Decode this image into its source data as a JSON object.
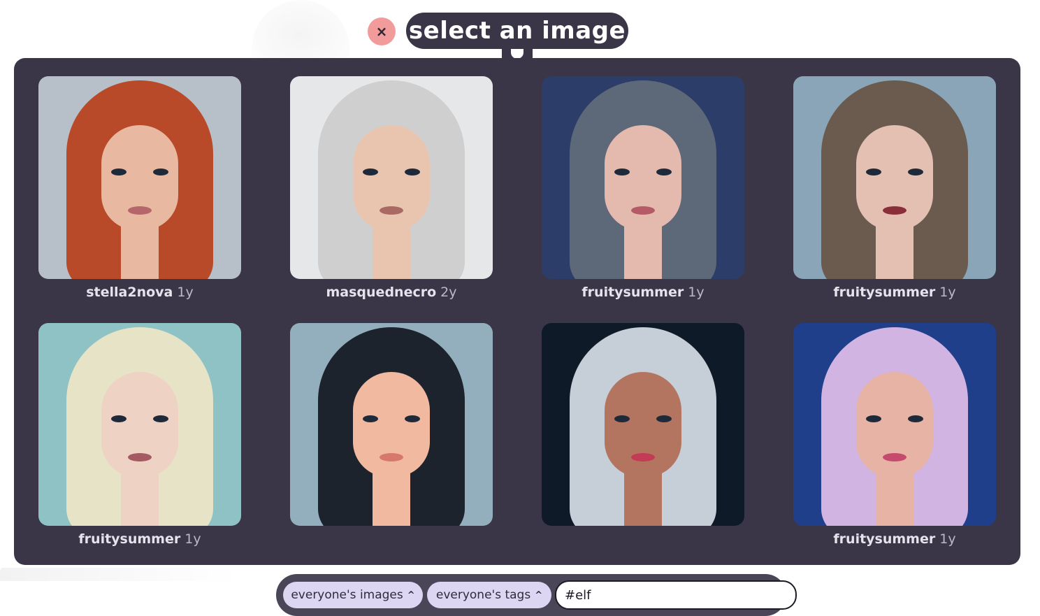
{
  "header": {
    "title": "select an image",
    "close_label": "×"
  },
  "gallery": [
    {
      "user": "stella2nova",
      "age": "1y",
      "hair": "#b84a2a",
      "skin": "#e8b9a0",
      "bg": "#b7c0c8",
      "lips": "#b5666a"
    },
    {
      "user": "masquednecro",
      "age": "2y",
      "hair": "#cfcfcf",
      "skin": "#e9c5b0",
      "bg": "#e6e7e9",
      "lips": "#a86a62"
    },
    {
      "user": "fruitysummer",
      "age": "1y",
      "hair": "#5d6878",
      "skin": "#e4b9ae",
      "bg": "#2b3d68",
      "lips": "#b55a66"
    },
    {
      "user": "fruitysummer",
      "age": "1y",
      "hair": "#6b5a4e",
      "skin": "#e3c0b2",
      "bg": "#8aa5b8",
      "lips": "#8a2f3a"
    },
    {
      "user": "fruitysummer",
      "age": "1y",
      "hair": "#e6e3c6",
      "skin": "#eed2c4",
      "bg": "#8fc2c4",
      "lips": "#a35a63"
    },
    {
      "user": "",
      "age": "",
      "hair": "#1c232c",
      "skin": "#f0b9a0",
      "bg": "#93aebd",
      "lips": "#d7786e"
    },
    {
      "user": "",
      "age": "",
      "hair": "#c6ced8",
      "skin": "#b37560",
      "bg": "#0f1a28",
      "lips": "#c43b55"
    },
    {
      "user": "fruitysummer",
      "age": "1y",
      "hair": "#d2b4e2",
      "skin": "#e6b3a4",
      "bg": "#1f3f8a",
      "lips": "#c54a6d"
    }
  ],
  "toolbar": {
    "images_filter": "everyone's images",
    "tags_filter": "everyone's tags",
    "search_value": "#elf",
    "chevron": "^"
  }
}
